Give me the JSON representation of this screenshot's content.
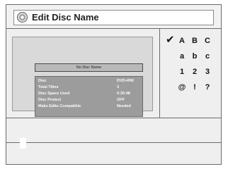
{
  "window": {
    "title": "Edit Disc Name",
    "icon": "disc-icon"
  },
  "disc_preview": {
    "name": "No Disc Name",
    "info": [
      {
        "label": "Disc",
        "value": "DVD+RW"
      },
      {
        "label": "Total Titles",
        "value": "3"
      },
      {
        "label": "Disc Space Used",
        "value": "0:30:48"
      },
      {
        "label": "Disc Protect",
        "value": "OFF"
      },
      {
        "label": "Make Edits Compatible",
        "value": "Needed"
      }
    ]
  },
  "character_sets": [
    {
      "chars": [
        "A",
        "B",
        "C"
      ],
      "selected": true
    },
    {
      "chars": [
        "a",
        "b",
        "c"
      ],
      "selected": false
    },
    {
      "chars": [
        "1",
        "2",
        "3"
      ],
      "selected": false
    },
    {
      "chars": [
        "@",
        "!",
        "?"
      ],
      "selected": false
    }
  ],
  "name_input": {
    "value": ""
  }
}
